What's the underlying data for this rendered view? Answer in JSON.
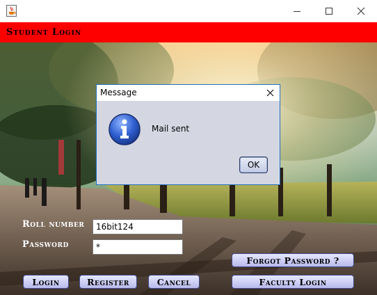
{
  "window": {
    "app_icon": "java-coffee-icon",
    "controls": {
      "minimize_icon": "minimize-icon",
      "maximize_icon": "maximize-icon",
      "close_icon": "close-icon"
    }
  },
  "header": {
    "title": "Student Login",
    "color": "#ff0000"
  },
  "form": {
    "roll_label": "Roll number",
    "roll_value": "16bit124",
    "password_label": "Password",
    "password_value": "*"
  },
  "buttons": {
    "forgot": "Forgot Password ?",
    "login": "Login",
    "register": "Register",
    "cancel": "Cancel",
    "faculty": "Faculty Login"
  },
  "dialog": {
    "title": "Message",
    "message": "Mail sent",
    "ok_label": "OK",
    "icon": "info-icon"
  }
}
